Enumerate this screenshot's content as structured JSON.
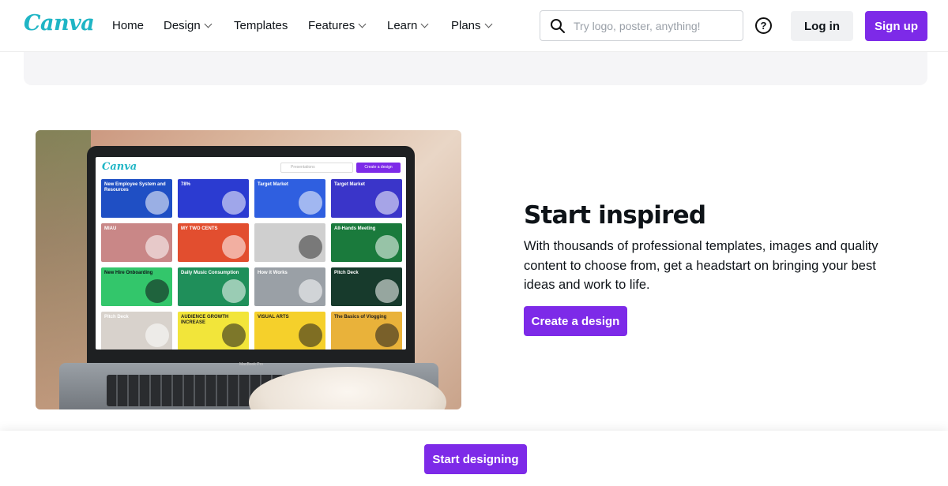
{
  "nav": {
    "logo": "Canva",
    "items": [
      {
        "label": "Home",
        "dropdown": false
      },
      {
        "label": "Design",
        "dropdown": true
      },
      {
        "label": "Templates",
        "dropdown": false
      },
      {
        "label": "Features",
        "dropdown": true
      },
      {
        "label": "Learn",
        "dropdown": true
      },
      {
        "label": "Plans",
        "dropdown": true
      }
    ],
    "search_placeholder": "Try logo, poster, anything!",
    "help_icon": "question-circle-icon",
    "login_label": "Log in",
    "signup_label": "Sign up"
  },
  "hero_image": {
    "app_logo": "Canva",
    "search_placeholder": "Presentations",
    "button_label": "Create a design",
    "laptop_brand": "MacBook Pro",
    "tiles": [
      {
        "text": "New Employee System and Resources",
        "bg": "#1f4fc4",
        "fg": "#ffffff"
      },
      {
        "text": "78%",
        "bg": "#2b3bd1",
        "fg": "#ffffff"
      },
      {
        "text": "Target Market",
        "bg": "#2f5fe0",
        "fg": "#ffffff"
      },
      {
        "text": "Target Market",
        "bg": "#3a35c9",
        "fg": "#ffffff"
      },
      {
        "text": "MIAU",
        "bg": "#c98787",
        "fg": "#ffffff"
      },
      {
        "text": "MY TWO CENTS",
        "bg": "#e24e2f",
        "fg": "#ffffff"
      },
      {
        "text": "",
        "bg": "#cfcfcf",
        "fg": "#333333"
      },
      {
        "text": "All-Hands Meeting",
        "bg": "#1a7a3c",
        "fg": "#ffffff"
      },
      {
        "text": "New Hire Onboarding",
        "bg": "#33c66b",
        "fg": "#0e1318"
      },
      {
        "text": "Daily Music Consumption",
        "bg": "#1f8f5a",
        "fg": "#ffffff"
      },
      {
        "text": "How it Works",
        "bg": "#9aa0a6",
        "fg": "#ffffff"
      },
      {
        "text": "Pitch Deck",
        "bg": "#173a2c",
        "fg": "#ffffff"
      },
      {
        "text": "Pitch Deck",
        "bg": "#d8d2cc",
        "fg": "#ffffff"
      },
      {
        "text": "AUDIENCE GROWTH INCREASE",
        "bg": "#f2e53a",
        "fg": "#1d1d1d"
      },
      {
        "text": "VISUAL ARTS",
        "bg": "#f5d02b",
        "fg": "#1d1d1d"
      },
      {
        "text": "The Basics of Vlogging",
        "bg": "#e9b23a",
        "fg": "#1d1d1d"
      }
    ]
  },
  "section": {
    "headline": "Start inspired",
    "description": "With thousands of professional templates, images and quality content to choose from, get a headstart on bringing your best ideas and work to life.",
    "cta_label": "Create a design"
  },
  "sticky_bar": {
    "button_label": "Start designing"
  },
  "colors": {
    "brand_purple": "#7d2ae8",
    "logo_teal": "#1fb5c5"
  }
}
